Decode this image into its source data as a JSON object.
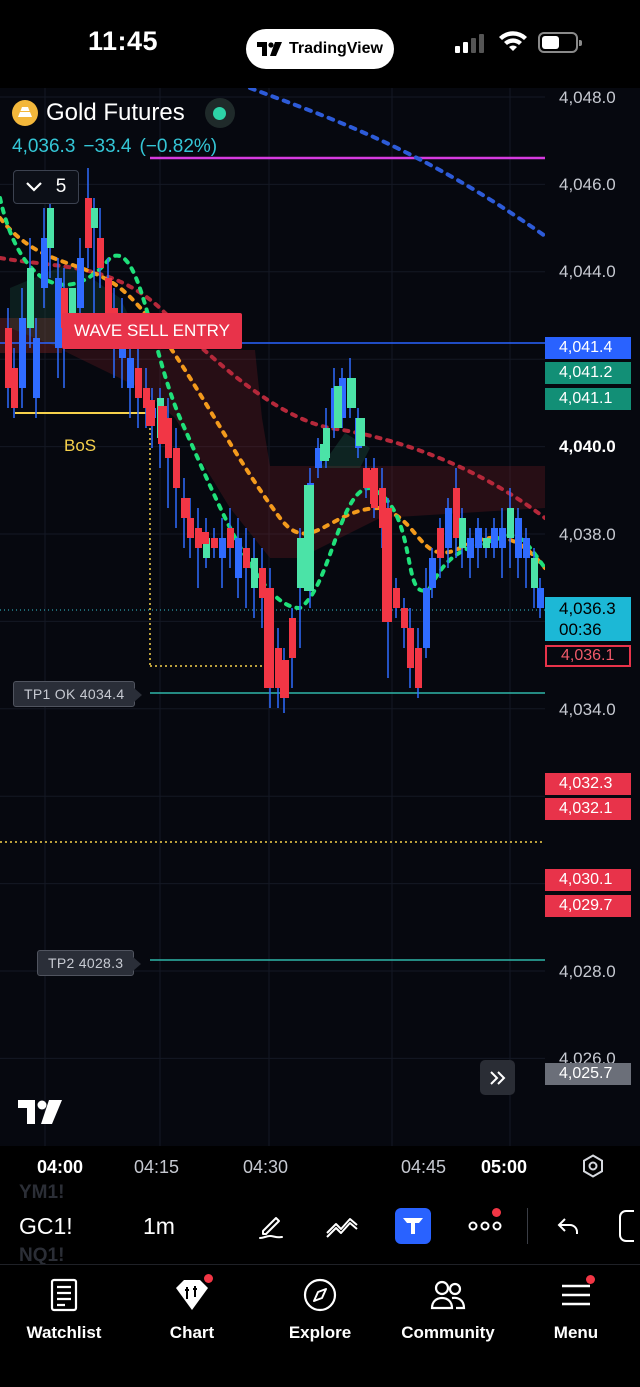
{
  "status_bar": {
    "time": "11:45",
    "app_pill": "TradingView"
  },
  "chart": {
    "symbol_name": "Gold Futures",
    "last_price": "4,036.3",
    "change": "−33.4",
    "change_pct": "(−0.82%)",
    "indicator_count": "5",
    "sell_label": "WAVE SELL ENTRY",
    "bos_label": "BoS",
    "tp1_label": "TP1 OK  4034.4",
    "tp2_label": "TP2  4028.3",
    "price_ticks": [
      "4,048.0",
      "4,046.0",
      "4,044.0",
      "4,040.0",
      "4,038.0",
      "4,034.0",
      "4,028.0",
      "4,026.0"
    ],
    "price_tags": {
      "blue": "4,041.4",
      "green_1": "4,041.2",
      "green_2": "4,041.1",
      "current_price": "4,036.3",
      "countdown": "00:36",
      "outline": "4,036.1",
      "red_1": "4,032.3",
      "red_2": "4,032.1",
      "red_3": "4,030.1",
      "red_4": "4,029.7",
      "gray": "4,025.7"
    },
    "colors": {
      "bull": "#4be3a7",
      "bear": "#f23645",
      "wick": "#2f6bff",
      "accent": "#2962ff",
      "quote": "#34c6d6"
    }
  },
  "time_axis": [
    "04:00",
    "04:15",
    "04:30",
    "04:45",
    "05:00"
  ],
  "toolbar": {
    "symbol": "GC1!",
    "ghost_above": "YM1!",
    "ghost_below": "NQ1!",
    "interval": "1m"
  },
  "bottom_nav": [
    {
      "label": "Watchlist",
      "icon": "watchlist-icon"
    },
    {
      "label": "Chart",
      "icon": "chart-icon"
    },
    {
      "label": "Explore",
      "icon": "compass-icon"
    },
    {
      "label": "Community",
      "icon": "community-icon"
    },
    {
      "label": "Menu",
      "icon": "menu-icon"
    }
  ]
}
